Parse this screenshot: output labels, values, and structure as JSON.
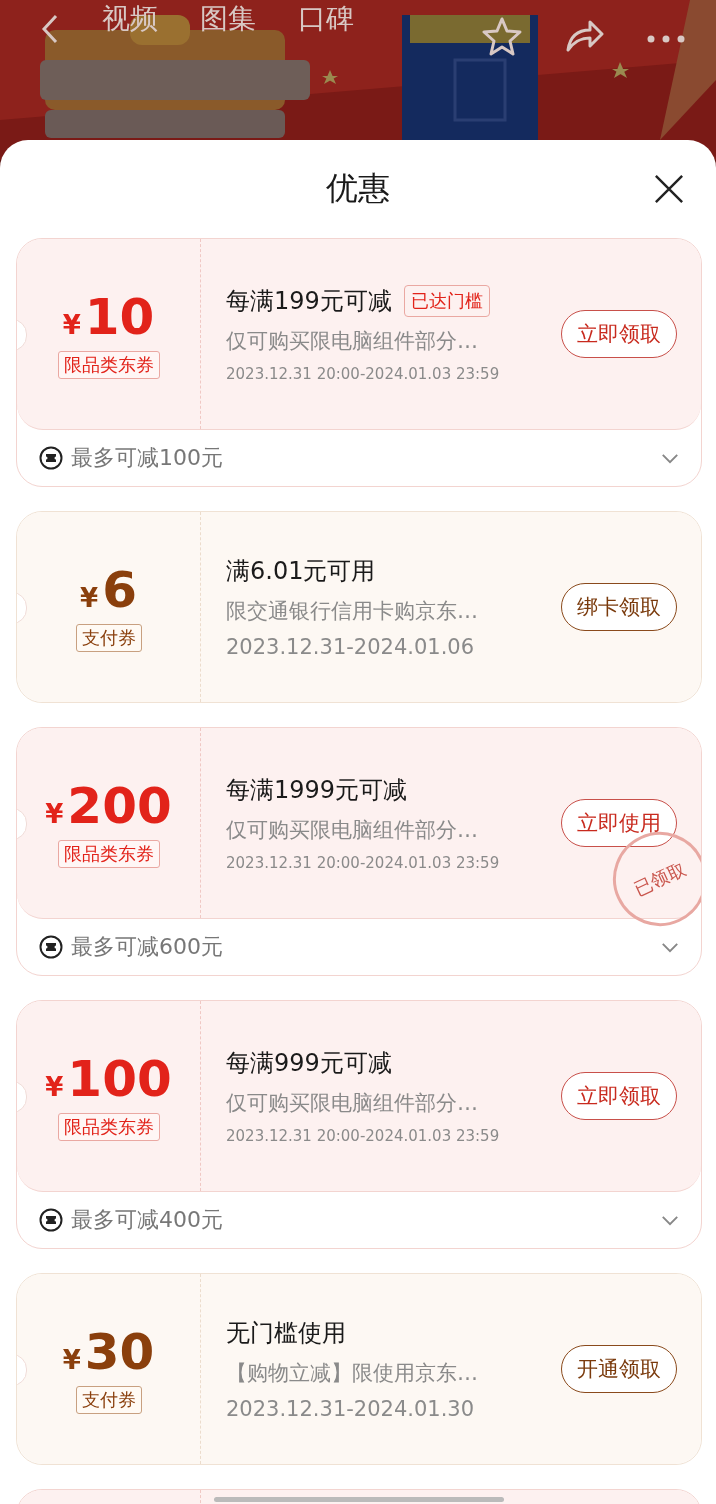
{
  "top_bar": {
    "tabs": [
      {
        "label": "视频",
        "selected": false
      },
      {
        "label": "图集",
        "selected": false
      },
      {
        "label": "口碑",
        "selected": false
      }
    ]
  },
  "sheet": {
    "title": "优惠"
  },
  "coupons": [
    {
      "kind": "category",
      "symbol": "¥",
      "amount": "10",
      "tag": "限品类东券",
      "title": "每满199元可减",
      "badge": "已达门槛",
      "desc": "仅可购买限电脑组件部分…",
      "date": "2023.12.31 20:00-2024.01.03 23:59",
      "button": "立即领取",
      "claimed": false,
      "footer": "最多可减100元"
    },
    {
      "kind": "payment",
      "symbol": "¥",
      "amount": "6",
      "tag": "支付券",
      "title": "满6.01元可用",
      "desc": "限交通银行信用卡购京东…",
      "date": "2023.12.31-2024.01.06",
      "button": "绑卡领取",
      "claimed": false
    },
    {
      "kind": "category",
      "symbol": "¥",
      "amount": "200",
      "tag": "限品类东券",
      "title": "每满1999元可减",
      "desc": "仅可购买限电脑组件部分…",
      "date": "2023.12.31 20:00-2024.01.03 23:59",
      "button": "立即使用",
      "claimed": true,
      "stamp": "已领取",
      "footer": "最多可减600元"
    },
    {
      "kind": "category",
      "symbol": "¥",
      "amount": "100",
      "tag": "限品类东券",
      "title": "每满999元可减",
      "desc": "仅可购买限电脑组件部分…",
      "date": "2023.12.31 20:00-2024.01.03 23:59",
      "button": "立即领取",
      "claimed": false,
      "footer": "最多可减400元"
    },
    {
      "kind": "payment",
      "symbol": "¥",
      "amount": "30",
      "tag": "支付券",
      "title": "无门槛使用",
      "desc": "【购物立减】限使用京东…",
      "date": "2023.12.31-2024.01.30",
      "button": "开通领取",
      "claimed": false
    },
    {
      "kind": "category",
      "claimed": false
    }
  ]
}
